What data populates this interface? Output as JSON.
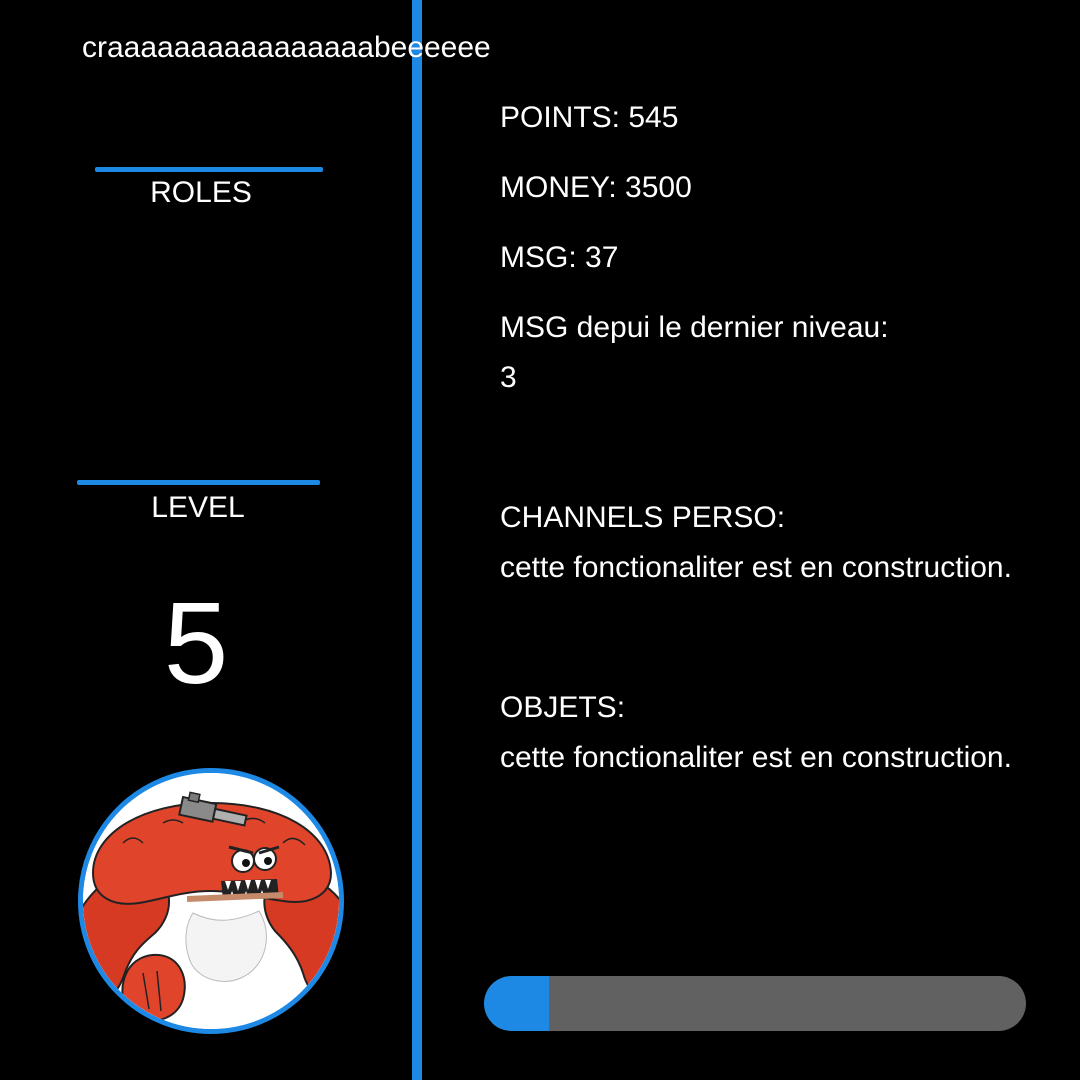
{
  "profile": {
    "username": "craaaaaaaaaaaaaaaabeeeeee",
    "roles_label": "ROLES",
    "level_label": "LEVEL",
    "level_value": "5",
    "avatar_icon": "red-crab-with-gun-avatar-icon"
  },
  "stats": {
    "points": "POINTS: 545",
    "money": "MONEY: 3500",
    "msg": "MSG: 37",
    "msg_since_level_label": "MSG depui le dernier niveau:",
    "msg_since_level_value": "3",
    "channels_label": "CHANNELS PERSO:",
    "channels_value": "cette fonctionaliter est en construction.",
    "objects_label": "OBJETS:",
    "objects_value": "cette fonctionaliter est en construction."
  },
  "progress": {
    "fraction": 0.12
  },
  "colors": {
    "background": "#000000",
    "accent": "#1e88e5",
    "track": "#616161",
    "text": "#ffffff"
  }
}
